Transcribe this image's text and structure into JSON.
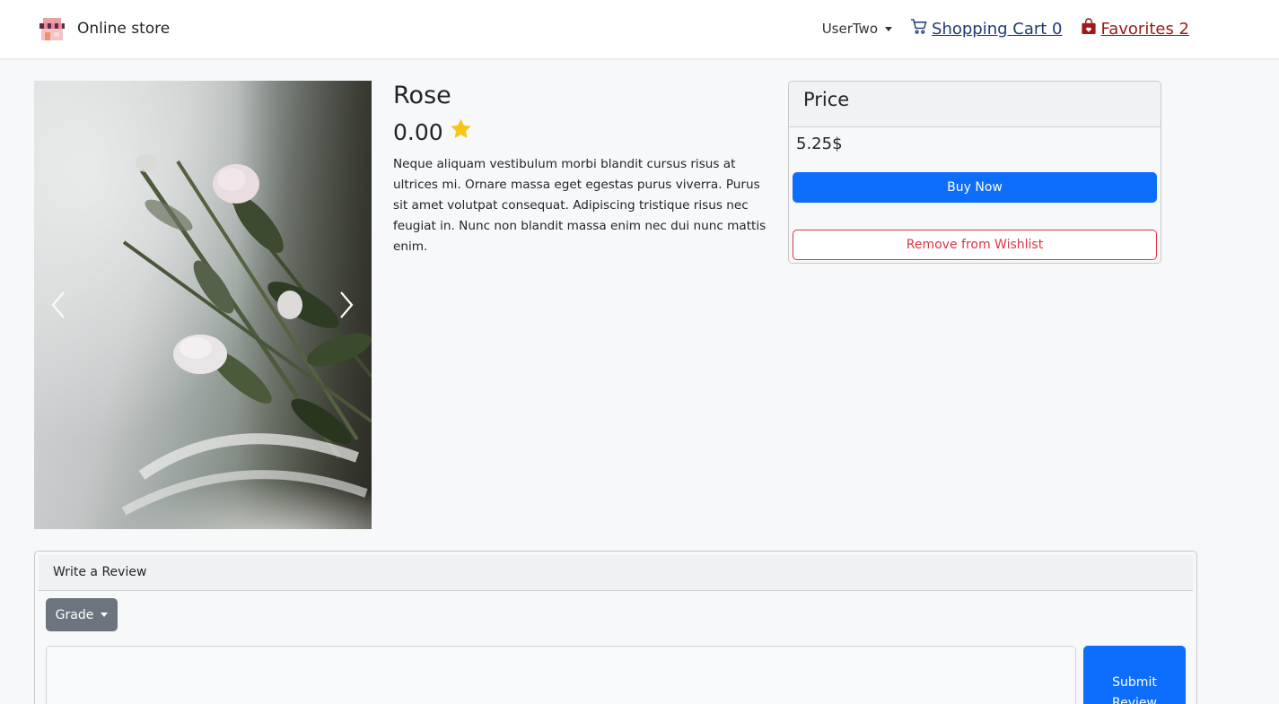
{
  "navbar": {
    "brand_name": "Online store",
    "user_name": "UserTwo",
    "cart_label": "Shopping Cart 0",
    "favorites_label": "Favorites 2"
  },
  "product": {
    "title": "Rose",
    "rating": "0.00",
    "description": "Neque aliquam vestibulum morbi blandit cursus risus at ultrices mi. Ornare massa eget egestas purus viverra. Purus sit amet volutpat consequat. Adipiscing tristique risus nec feugiat in. Nunc non blandit massa enim nec dui nunc mattis enim."
  },
  "price_card": {
    "header": "Price",
    "value": "5.25$",
    "buy_label": "Buy Now",
    "remove_label": "Remove from Wishlist"
  },
  "review": {
    "header": "Write a Review",
    "grade_label": "Grade",
    "submit_label": "Submit Review",
    "text_value": ""
  },
  "icons": {
    "brand": "store-icon",
    "cart": "cart-icon",
    "favorites": "bag-heart-icon",
    "rating": "star-icon",
    "prev": "chevron-left-icon",
    "next": "chevron-right-icon"
  },
  "colors": {
    "primary": "#0d6efd",
    "danger": "#dc3545",
    "secondary": "#6c757d",
    "cart_link": "#1e3a75",
    "favorites_link": "#a01818",
    "star": "#f5c518"
  }
}
